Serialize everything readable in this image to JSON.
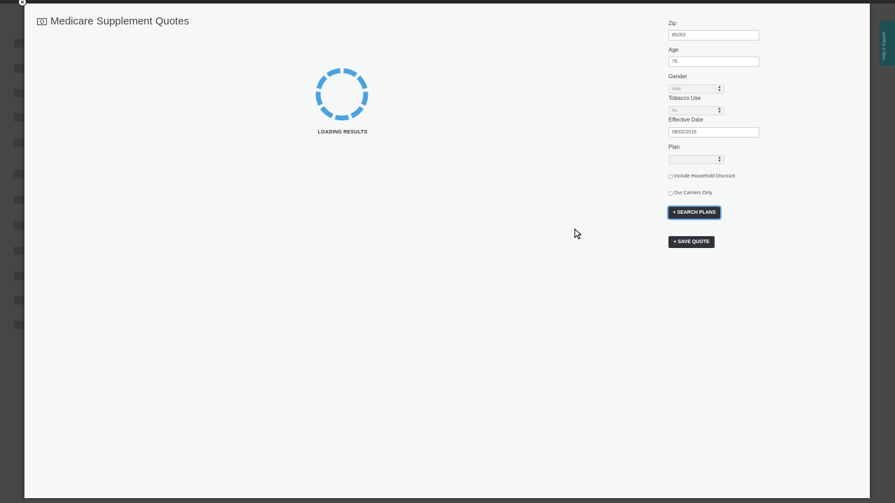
{
  "modal": {
    "title": "Medicare Supplement Quotes",
    "title_icon": "money-icon",
    "close_icon": "close-icon"
  },
  "loading": {
    "text": "LOADING RESULTS",
    "color": "#4aa3df"
  },
  "form": {
    "zip": {
      "label": "Zip",
      "value": "85283"
    },
    "age": {
      "label": "Age",
      "value": "76"
    },
    "gender": {
      "label": "Gender",
      "value": "Male"
    },
    "tobacco": {
      "label": "Tobacco Use",
      "value": "No"
    },
    "effective_date": {
      "label": "Effective Date",
      "value": "08/02/2016"
    },
    "plan": {
      "label": "Plan",
      "value": ""
    },
    "household_discount": {
      "label": "Include Household Discount",
      "checked": false
    },
    "our_carriers": {
      "label": "Our Carriers Only",
      "checked": false
    },
    "search_button": "+ SEARCH PLANS",
    "save_button": "+ SAVE QUOTE"
  },
  "background": {
    "help_tab": "Help & Support"
  }
}
